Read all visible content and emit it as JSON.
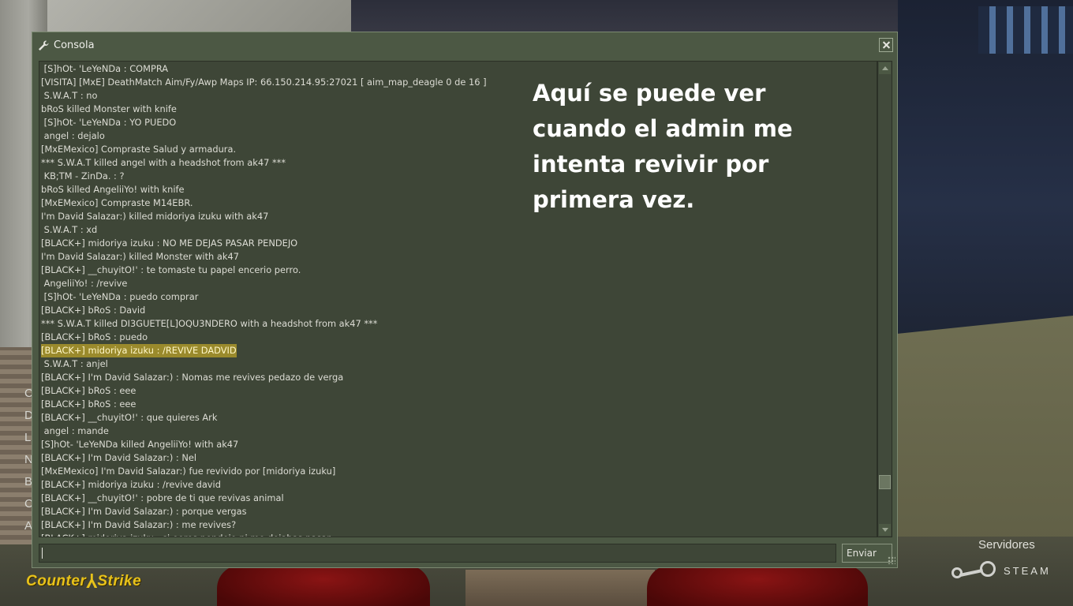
{
  "window": {
    "title": "Consola",
    "close_label": "✕"
  },
  "log": {
    "lines": [
      " [S]hOt- 'LeYeNDa : COMPRA",
      "[VISITA] [MxE] DeathMatch Aim/Fy/Awp Maps IP: 66.150.214.95:27021 [ aim_map_deagle 0 de 16 ]",
      " S.W.A.T : no",
      "bRoS killed Monster with knife",
      " [S]hOt- 'LeYeNDa : YO PUEDO",
      " angel : dejalo",
      "[MxEMexico] Compraste Salud y armadura.",
      "*** S.W.A.T killed angel with a headshot from ak47 ***",
      " KB;TM - ZinDa. : ?",
      "bRoS killed AngeliiYo! with knife",
      "[MxEMexico] Compraste M14EBR.",
      "I'm David Salazar:) killed midoriya izuku with ak47",
      " S.W.A.T : xd",
      "[BLACK+] midoriya izuku : NO ME DEJAS PASAR PENDEJO",
      "I'm David Salazar:) killed Monster with ak47",
      "[BLACK+] __chuyitO!' : te tomaste tu papel encerio perro.",
      " AngeliiYo! : /revive",
      " [S]hOt- 'LeYeNDa : puedo comprar",
      "[BLACK+] bRoS : David",
      "*** S.W.A.T killed DI3GUETE[L]OQU3NDERO with a headshot from ak47 ***",
      "[BLACK+] bRoS : puedo",
      "[BLACK+] midoriya izuku : /REVIVE DADVID",
      " S.W.A.T : anjel",
      "[BLACK+] I'm David Salazar:) : Nomas me revives pedazo de verga",
      "[BLACK+] bRoS : eee",
      "[BLACK+] bRoS : eee",
      "[BLACK+] __chuyitO!' : que quieres Ark",
      " angel : mande",
      "[S]hOt- 'LeYeNDa killed AngeliiYo! with ak47",
      "[BLACK+] I'm David Salazar:) : Nel",
      "[MxEMexico] I'm David Salazar:) fue revivido por [midoriya izuku]",
      "[BLACK+] midoriya izuku : /revive david",
      "[BLACK+] __chuyitO!' : pobre de ti que revivas animal",
      "[BLACK+] I'm David Salazar:) : porque vergas",
      "[BLACK+] I'm David Salazar:) : me revives?",
      "[BLACK+] midoriya izuku : si eeres pendejo ni me dejabas pasar"
    ],
    "highlighted_index": 21
  },
  "input": {
    "value": "",
    "send_label": "Enviar"
  },
  "annotation": {
    "lines": [
      "Aquí se puede ver",
      "cuando el admin me",
      "intenta revivir por",
      "primera vez."
    ]
  },
  "background": {
    "menu_letters": [
      "C",
      "D",
      "L",
      "",
      "N",
      "B",
      "C",
      "A"
    ],
    "logo": {
      "left": "Counter",
      "right": "Strike"
    },
    "servers_label": "Servidores",
    "steam_label": "STEAM"
  },
  "colors": {
    "console_bg": "#4c5844",
    "log_bg": "#3e4637",
    "highlight": "#9a8a2c",
    "logo": "#e8c21a"
  }
}
